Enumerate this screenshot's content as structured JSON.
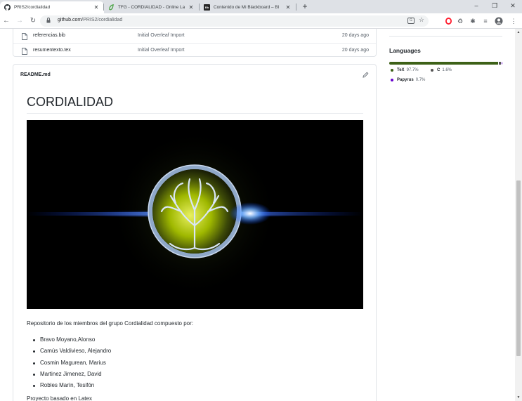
{
  "browser": {
    "tabs": [
      {
        "title": "PRIS2/cordialidad",
        "icon": "github-icon",
        "active": true
      },
      {
        "title": "TFG - CORDIALIDAD - Online La",
        "icon": "overleaf-icon",
        "active": false
      },
      {
        "title": "Contenido de Mi Blackboard – Bl",
        "icon": "blackboard-icon",
        "active": false
      }
    ],
    "tab_close": "✕",
    "new_tab": "+",
    "address": {
      "host": "github.com",
      "path": "/PRIS2/cordialidad"
    },
    "window_controls": {
      "minimize": "–",
      "maximize": "❐",
      "close": "✕"
    }
  },
  "files": [
    {
      "name": "referencias.bib",
      "message": "Initial Overleaf Import",
      "age": "20 days ago"
    },
    {
      "name": "resumentexto.tex",
      "message": "Initial Overleaf Import",
      "age": "20 days ago"
    }
  ],
  "readme": {
    "filename": "README.md",
    "heading": "CORDIALIDAD",
    "description": "Repositorio de los miembros del grupo Cordialidad compuesto por:",
    "members": [
      "Bravo Moyano,Alonso",
      "Camús Valdivieso, Alejandro",
      "Cosmin Magurean, Marius",
      "Martinez Jimenez, David",
      "Robles Marín, Tesifón"
    ],
    "trailing_text": "Proyecto basado en Latex"
  },
  "languages": {
    "title": "Languages",
    "items": [
      {
        "name": "TeX",
        "percent": "97.7%",
        "value": 97.7,
        "color": "#3d6117"
      },
      {
        "name": "C",
        "percent": "1.6%",
        "value": 1.6,
        "color": "#555555"
      },
      {
        "name": "Papyrus",
        "percent": "0.7%",
        "value": 0.7,
        "color": "#6600cc"
      }
    ]
  }
}
